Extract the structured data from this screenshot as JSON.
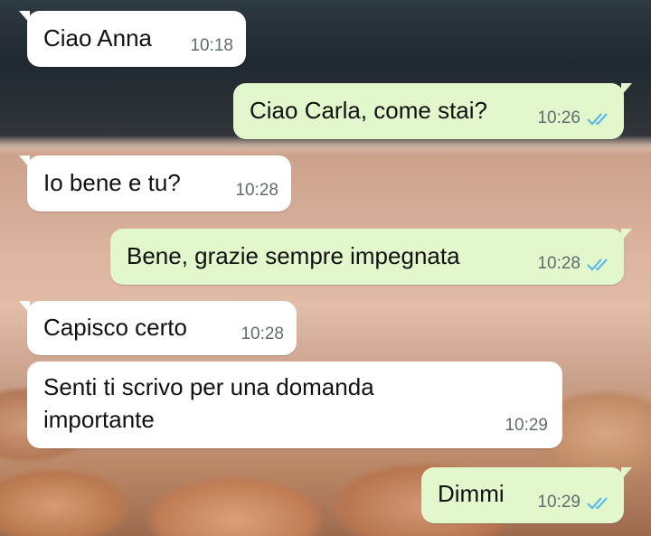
{
  "chat": {
    "messages": [
      {
        "direction": "incoming",
        "text": "Ciao Anna",
        "time": "10:18"
      },
      {
        "direction": "outgoing",
        "text": "Ciao Carla, come stai?",
        "time": "10:26",
        "status": "read"
      },
      {
        "direction": "incoming",
        "text": "Io bene e tu?",
        "time": "10:28"
      },
      {
        "direction": "outgoing",
        "text": "Bene, grazie sempre impegnata",
        "time": "10:28",
        "status": "read"
      },
      {
        "direction": "incoming",
        "text": "Capisco certo",
        "time": "10:28"
      },
      {
        "direction": "incoming",
        "text_line1": "Senti ti scrivo per una domanda",
        "text_line2": "importante",
        "time": "10:29"
      },
      {
        "direction": "outgoing",
        "text": "Dimmi",
        "time": "10:29",
        "status": "read"
      }
    ]
  },
  "colors": {
    "incoming_bubble": "#ffffff",
    "outgoing_bubble": "#e2f7cb",
    "read_ticks": "#4fb6ec",
    "timestamp": "#5f6b6f"
  },
  "icons": {
    "read_status": "double-check-icon"
  }
}
